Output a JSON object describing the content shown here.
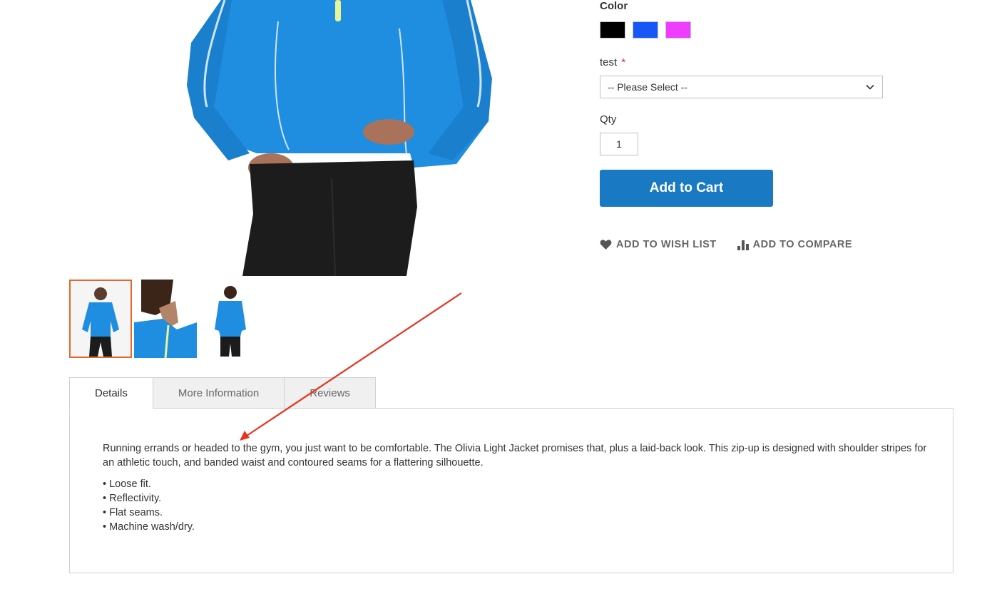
{
  "product_options": {
    "color_label": "Color",
    "swatches": [
      {
        "name": "Black",
        "color": "#000000"
      },
      {
        "name": "Blue",
        "color": "#1857f7"
      },
      {
        "name": "Purple",
        "color": "#ef3dff"
      }
    ],
    "test_label": "test",
    "required_marker": "*",
    "test_select_value": "-- Please Select --",
    "qty_label": "Qty",
    "qty_value": "1",
    "add_to_cart_label": "Add to Cart",
    "wish_list_label": "ADD TO WISH LIST",
    "compare_label": "ADD TO COMPARE"
  },
  "gallery": {
    "thumbnail_count": 3,
    "active_index": 0
  },
  "tabs": [
    {
      "label": "Details",
      "active": true
    },
    {
      "label": "More Information",
      "active": false
    },
    {
      "label": "Reviews",
      "active": false
    }
  ],
  "details": {
    "description": "Running errands or headed to the gym, you just want to be comfortable. The Olivia Light Jacket promises that, plus a laid-back look. This zip-up is designed with shoulder stripes for an athletic touch, and banded waist and contoured seams for a flattering silhouette.",
    "bullets": [
      "• Loose fit.",
      "• Reflectivity.",
      "• Flat seams.",
      "• Machine wash/dry."
    ]
  },
  "colors": {
    "primary_button": "#1979c3",
    "thumb_active_border": "#e0682e",
    "annotation_arrow": "#e8321e",
    "required": "#e02b27"
  }
}
